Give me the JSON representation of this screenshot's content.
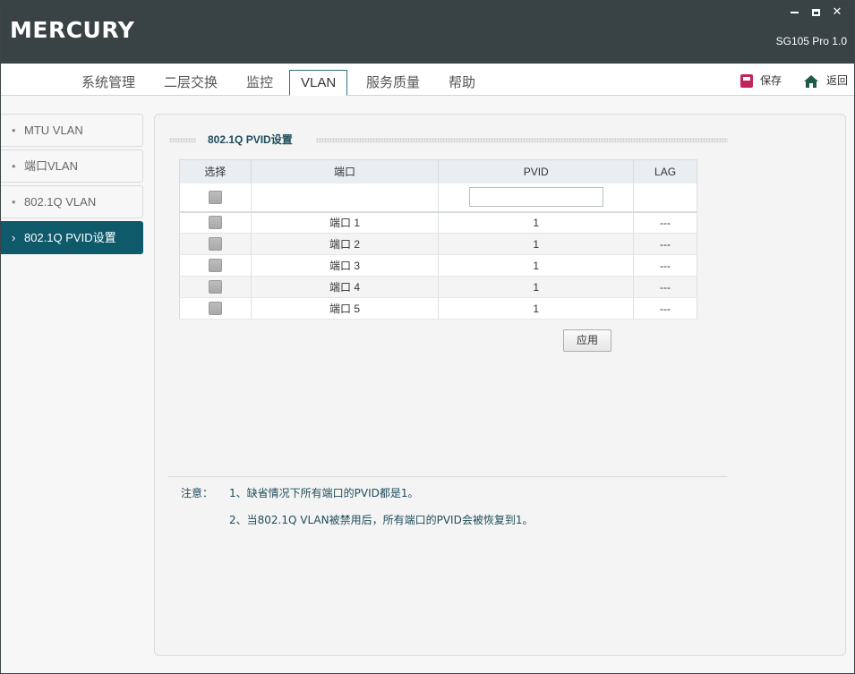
{
  "titlebar": {
    "logo": "MERCURY",
    "model": "SG105 Pro 1.0"
  },
  "tabs": [
    {
      "label": "系统管理",
      "active": false
    },
    {
      "label": "二层交换",
      "active": false
    },
    {
      "label": "监控",
      "active": false
    },
    {
      "label": "VLAN",
      "active": true
    },
    {
      "label": "服务质量",
      "active": false
    },
    {
      "label": "帮助",
      "active": false
    }
  ],
  "actions": {
    "save_label": "保存",
    "back_label": "返回"
  },
  "sidebar": {
    "items": [
      {
        "label": "MTU VLAN",
        "bullet": "•",
        "active": false
      },
      {
        "label": "端口VLAN",
        "bullet": "•",
        "active": false
      },
      {
        "label": "802.1Q VLAN",
        "bullet": "•",
        "active": false
      },
      {
        "label": "802.1Q PVID设置",
        "bullet": "›",
        "active": true
      }
    ]
  },
  "section": {
    "title": "802.1Q PVID设置"
  },
  "table": {
    "headers": [
      "选择",
      "端口",
      "PVID",
      "LAG"
    ],
    "filter": {
      "pvid_value": ""
    },
    "rows": [
      {
        "port": "端口 1",
        "pvid": "1",
        "lag": "---"
      },
      {
        "port": "端口 2",
        "pvid": "1",
        "lag": "---"
      },
      {
        "port": "端口 3",
        "pvid": "1",
        "lag": "---"
      },
      {
        "port": "端口 4",
        "pvid": "1",
        "lag": "---"
      },
      {
        "port": "端口 5",
        "pvid": "1",
        "lag": "---"
      }
    ]
  },
  "apply_label": "应用",
  "notes": {
    "label": "注意：",
    "lines": [
      "1、缺省情况下所有端口的PVID都是1。",
      "2、当802.1Q VLAN被禁用后，所有端口的PVID会被恢复到1。"
    ]
  },
  "colors": {
    "titlebar": "#394245",
    "accent": "#0e5a6b",
    "save_icon": "#c0255e",
    "home_icon": "#1e5a4a"
  }
}
